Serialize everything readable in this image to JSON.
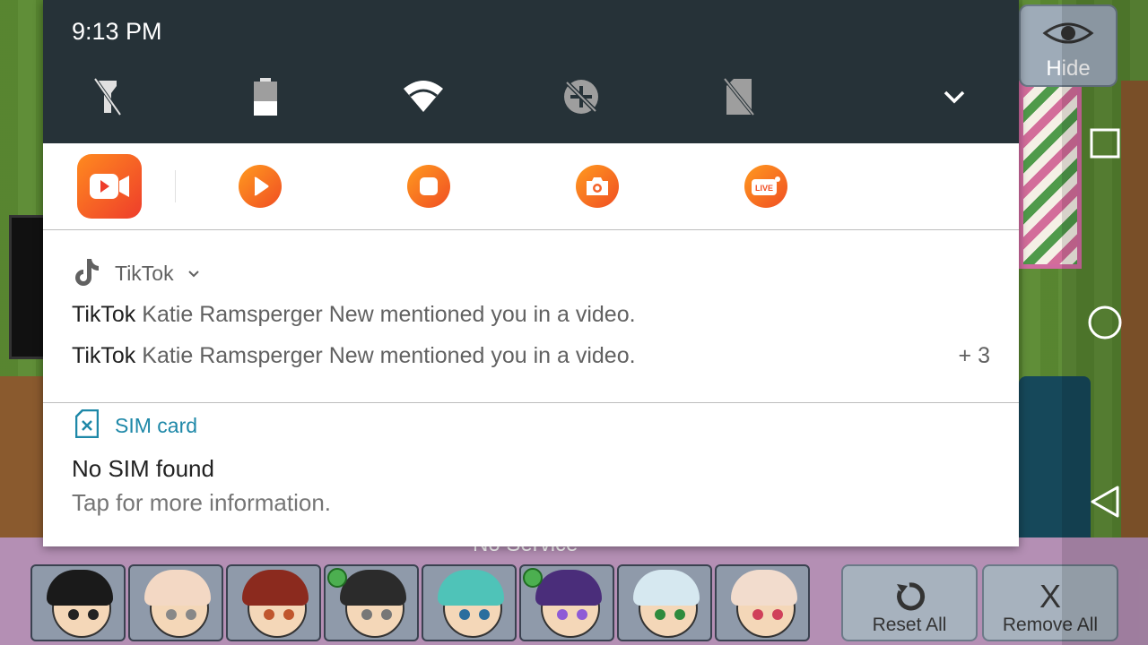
{
  "status": {
    "time": "9:13 PM"
  },
  "quick_settings": {
    "tiles": [
      "flashlight-off-icon",
      "battery-icon",
      "wifi-icon",
      "data-saver-icon",
      "no-sim-icon"
    ],
    "expand_icon": "chevron-down-icon"
  },
  "recorder_apps": [
    "screen-recorder-icon",
    "video-play-icon",
    "stop-record-icon",
    "screenshot-camera-icon",
    "live-stream-icon"
  ],
  "recorder_live_label": "LIVE",
  "tiktok_notification": {
    "app_name": "TikTok",
    "lines": [
      {
        "title": "TikTok",
        "text": "Katie Ramsperger New mentioned you in a video."
      },
      {
        "title": "TikTok",
        "text": "Katie Ramsperger New mentioned you in a video."
      }
    ],
    "more_count": "+ 3"
  },
  "sim_notification": {
    "app_name": "SIM card",
    "title": "No SIM found",
    "text": "Tap for more information."
  },
  "background": {
    "hide_label": "Hide",
    "no_service": "No Service",
    "reset_label": "Reset All",
    "remove_label": "Remove All",
    "remove_glyph": "X"
  },
  "characters": [
    {
      "hair": "#1a1a1a",
      "eye": "#222",
      "selected": false
    },
    {
      "hair": "#f3d8c4",
      "eye": "#888",
      "selected": false
    },
    {
      "hair": "#8b2a1e",
      "eye": "#c0562d",
      "selected": false
    },
    {
      "hair": "#2b2b2b",
      "eye": "#777",
      "selected": true
    },
    {
      "hair": "#4fc3b8",
      "eye": "#2a6e9e",
      "selected": false
    },
    {
      "hair": "#4a2d7a",
      "eye": "#8e5bd6",
      "selected": true
    },
    {
      "hair": "#d6e8f0",
      "eye": "#2e8b3d",
      "selected": false
    },
    {
      "hair": "#f2dccd",
      "eye": "#d0405a",
      "selected": false
    }
  ]
}
